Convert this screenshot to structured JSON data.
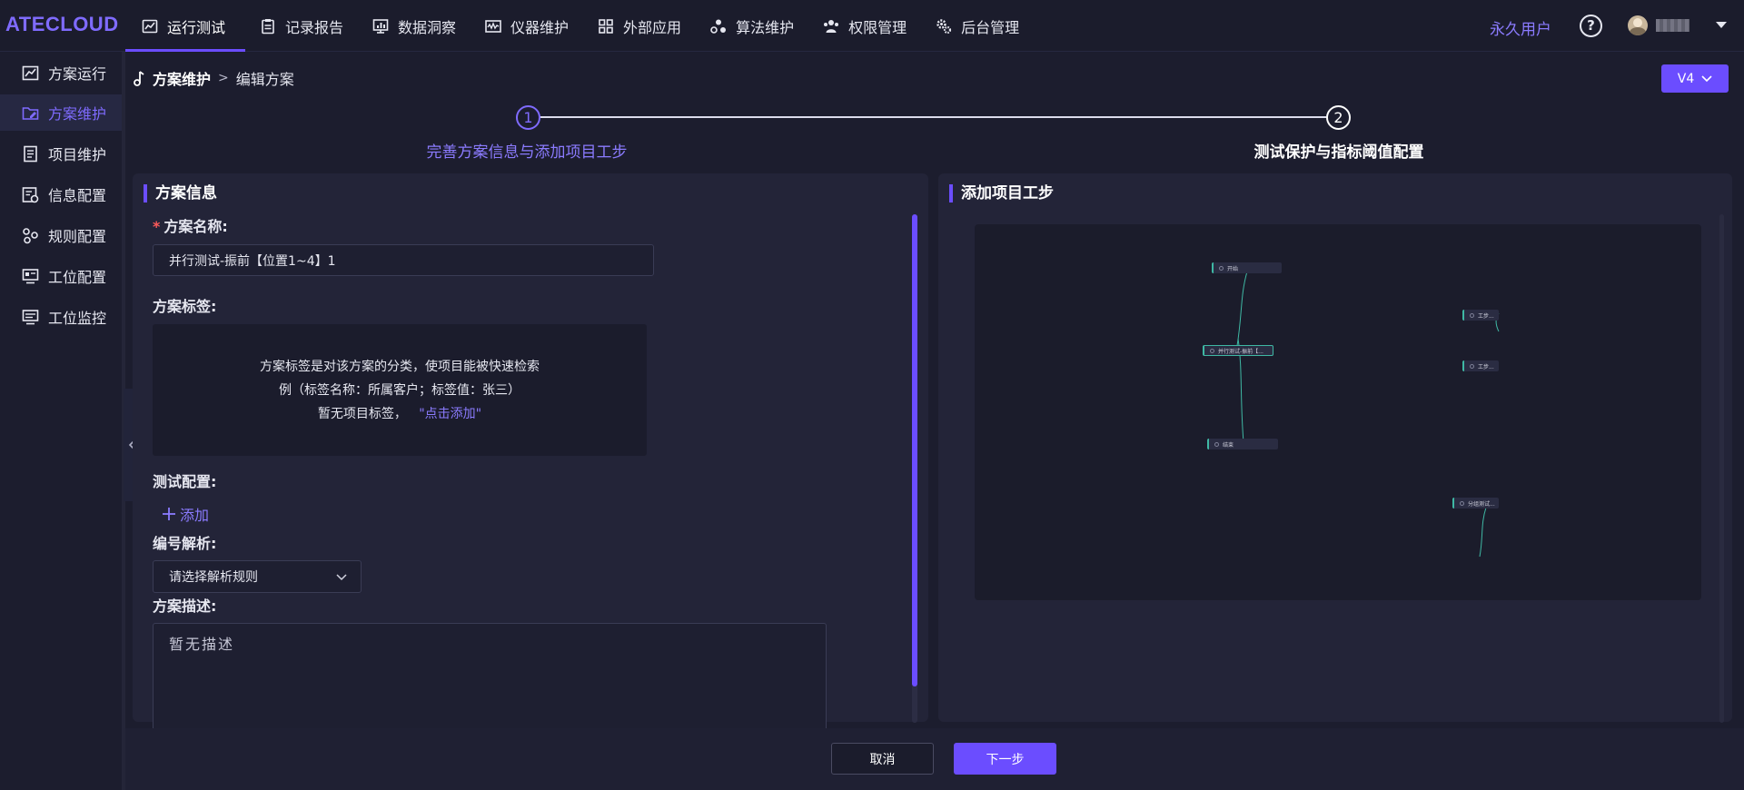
{
  "app": {
    "logo": "ATECLOUD"
  },
  "nav": {
    "items": [
      {
        "label": "运行测试",
        "icon": "chart-line-icon",
        "active": true
      },
      {
        "label": "记录报告",
        "icon": "clipboard-icon",
        "active": false
      },
      {
        "label": "数据洞察",
        "icon": "bar-chart-icon",
        "active": false
      },
      {
        "label": "仪器维护",
        "icon": "oscilloscope-icon",
        "active": false
      },
      {
        "label": "外部应用",
        "icon": "grid-apps-icon",
        "active": false
      },
      {
        "label": "算法维护",
        "icon": "molecule-icon",
        "active": false
      },
      {
        "label": "权限管理",
        "icon": "users-icon",
        "active": false
      },
      {
        "label": "后台管理",
        "icon": "gears-icon",
        "active": false
      }
    ],
    "user_type": "永久用户",
    "help_label": "?"
  },
  "sidebar": {
    "items": [
      {
        "label": "方案运行",
        "icon": "chart-line-icon",
        "active": false
      },
      {
        "label": "方案维护",
        "icon": "folder-edit-icon",
        "active": true
      },
      {
        "label": "项目维护",
        "icon": "document-icon",
        "active": false
      },
      {
        "label": "信息配置",
        "icon": "info-settings-icon",
        "active": false
      },
      {
        "label": "规则配置",
        "icon": "rules-icon",
        "active": false
      },
      {
        "label": "工位配置",
        "icon": "workstation-icon",
        "active": false
      },
      {
        "label": "工位监控",
        "icon": "monitor-icon",
        "active": false
      }
    ]
  },
  "breadcrumb": {
    "root": "方案维护",
    "separator": ">",
    "current": "编辑方案"
  },
  "version": {
    "label": "V4"
  },
  "steps": [
    {
      "number": "1",
      "label": "完善方案信息与添加项目工步",
      "active": true
    },
    {
      "number": "2",
      "label": "测试保护与指标阈值配置",
      "active": false
    }
  ],
  "plan_info": {
    "title": "方案信息",
    "name_label": "方案名称:",
    "required_mark": "*",
    "name_value": "并行测试-振前【位置1~4】1",
    "tags_label": "方案标签:",
    "tags_hint_line1": "方案标签是对该方案的分类，使项目能被快速检索",
    "tags_hint_line2": "例（标签名称：所属客户；标签值：张三）",
    "tags_empty": "暂无项目标签，",
    "tags_add_link": "\"点击添加\"",
    "test_config_label": "测试配置:",
    "add_button": "添加",
    "parse_label": "编号解析:",
    "parse_placeholder": "请选择解析规则",
    "desc_label": "方案描述:",
    "desc_value": "暂无描述"
  },
  "project_steps": {
    "title": "添加项目工步",
    "nodes": [
      {
        "id": "start",
        "label": "开始"
      },
      {
        "id": "parallel",
        "label": "并行测试-振前【..."
      },
      {
        "id": "end",
        "label": "结束"
      },
      {
        "id": "right1",
        "label": "工步..."
      },
      {
        "id": "right2",
        "label": "工步..."
      },
      {
        "id": "right3",
        "label": "分组测试..."
      }
    ]
  },
  "footer": {
    "cancel_label": "取消",
    "next_label": "下一步"
  },
  "colors": {
    "accent": "#6b4dff",
    "accent_text": "#8b7bff",
    "background": "#1c1d2e",
    "panel": "#232438",
    "edge": "#3fb8a4"
  }
}
